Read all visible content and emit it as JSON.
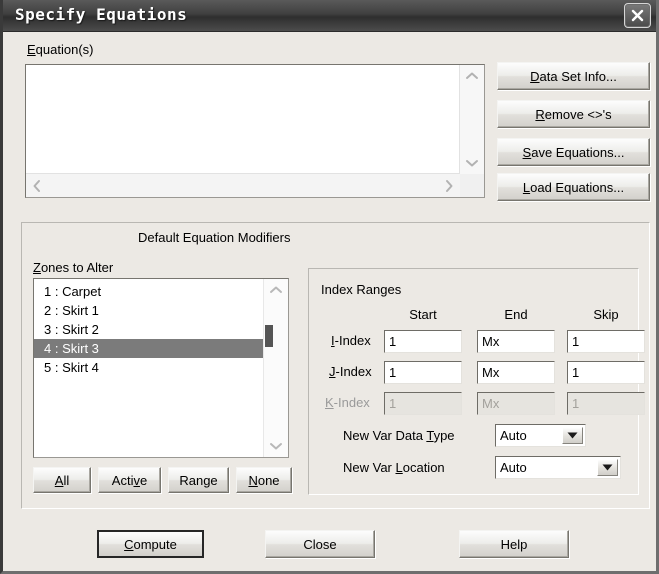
{
  "window": {
    "title": "Specify Equations",
    "close_icon": "close-x-icon"
  },
  "equations": {
    "label": "Equation(s)",
    "label_accel": "E",
    "value": "",
    "scroll_up_icon": "chevron-up-icon",
    "scroll_down_icon": "chevron-down-icon",
    "scroll_left_icon": "chevron-left-icon",
    "scroll_right_icon": "chevron-right-icon"
  },
  "side_buttons": [
    {
      "label": "Data Set Info...",
      "accel": "D"
    },
    {
      "label": "Remove <>'s",
      "accel": "R"
    },
    {
      "label": "Save Equations...",
      "accel": "S"
    },
    {
      "label": "Load Equations...",
      "accel": "L"
    }
  ],
  "modifiers": {
    "title": "Default Equation Modifiers",
    "zones_label": "Zones to Alter",
    "zones_label_accel": "Z",
    "zones": [
      {
        "text": "1 : Carpet",
        "selected": false
      },
      {
        "text": "2 : Skirt 1",
        "selected": false
      },
      {
        "text": "3 : Skirt 2",
        "selected": false
      },
      {
        "text": "4 : Skirt 3",
        "selected": true
      },
      {
        "text": "5 : Skirt 4",
        "selected": false
      }
    ],
    "zone_buttons": [
      {
        "label": "All",
        "accel": "A"
      },
      {
        "label": "Active",
        "accel": "v"
      },
      {
        "label": "Range",
        "accel": "g"
      },
      {
        "label": "None",
        "accel": "N"
      }
    ]
  },
  "index_ranges": {
    "title": "Index Ranges",
    "columns": [
      "Start",
      "End",
      "Skip"
    ],
    "rows": [
      {
        "label": "I-Index",
        "accel": "I",
        "start": "1",
        "end": "Mx",
        "skip": "1",
        "enabled": true
      },
      {
        "label": "J-Index",
        "accel": "J",
        "start": "1",
        "end": "Mx",
        "skip": "1",
        "enabled": true
      },
      {
        "label": "K-Index",
        "accel": "K",
        "start": "1",
        "end": "Mx",
        "skip": "1",
        "enabled": false
      }
    ]
  },
  "new_var": {
    "data_type_label": "New Var Data Type",
    "data_type_accel": "T",
    "data_type_value": "Auto",
    "location_label": "New Var Location",
    "location_accel": "L",
    "location_value": "Auto",
    "dropdown_icon": "caret-down-icon"
  },
  "footer_buttons": [
    {
      "label": "Compute",
      "accel": "C",
      "default": true
    },
    {
      "label": "Close",
      "accel": "",
      "default": false
    },
    {
      "label": "Help",
      "accel": "",
      "default": false
    }
  ],
  "colors": {
    "dialog_background": "#ece9e4",
    "titlebar": "#3f3f3f",
    "selection": "#7b7b7b",
    "field_background": "#ffffff",
    "disabled_text": "#a3a19c"
  }
}
